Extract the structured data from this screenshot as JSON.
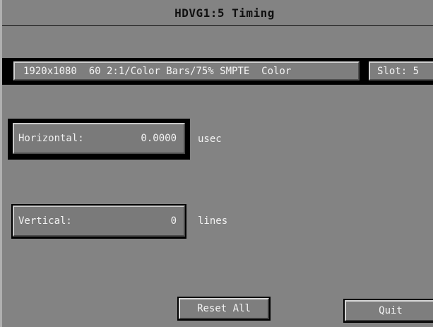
{
  "window": {
    "title": "HDVG1:5  Timing"
  },
  "info": {
    "format": "1920x1080  60 2:1/Color Bars/75% SMPTE  Color",
    "slot": "Slot: 5"
  },
  "timing": {
    "horizontal": {
      "label": "Horizontal:",
      "value": "0.0000",
      "unit": "usec"
    },
    "vertical": {
      "label": "Vertical:",
      "value": "0",
      "unit": "lines"
    }
  },
  "buttons": {
    "reset_all": "Reset All",
    "quit": "Quit"
  }
}
